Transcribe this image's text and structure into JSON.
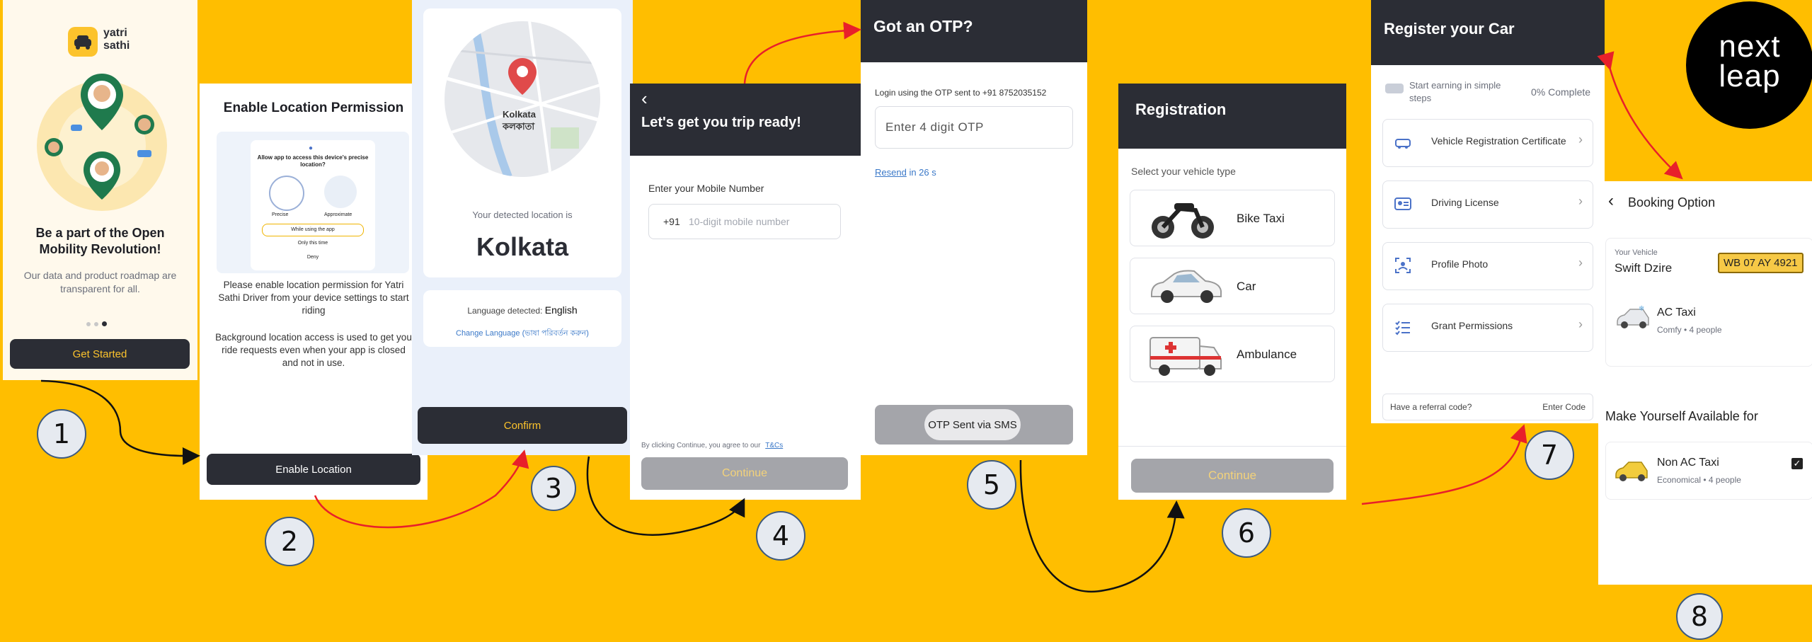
{
  "screen1": {
    "brand_line1": "yatri",
    "brand_line2": "sathi",
    "headline": "Be a part of the Open Mobility Revolution!",
    "subtext": "Our data and product roadmap are transparent for all.",
    "cta": "Get Started"
  },
  "screen2": {
    "title": "Enable Location Permission",
    "dialog_title": "Allow app to access this device's precise location?",
    "precise": "Precise",
    "approximate": "Approximate",
    "opt_while": "While using the app",
    "opt_once": "Only this time",
    "opt_deny": "Deny",
    "para1": "Please enable location permission for Yatri Sathi Driver from your device settings to start riding",
    "para2": "Background location access is used to get you ride requests even when your app is closed and not in use.",
    "cta": "Enable Location"
  },
  "screen3": {
    "map_label_en": "Kolkata",
    "map_label_bn": "কলকাতা",
    "detected_label": "Your detected location is",
    "city": "Kolkata",
    "lang_label": "Language detected:",
    "lang_value": "English",
    "change_lang": "Change Language (ভাষা পরিবর্তন করুন)",
    "cta": "Confirm"
  },
  "screen4": {
    "back": "‹",
    "title": "Let's get you trip ready!",
    "mobile_label": "Enter your Mobile Number",
    "prefix": "+91",
    "mobile_placeholder": "10-digit mobile number",
    "terms_prefix": "By clicking Continue, you agree to our",
    "terms_link": "T&Cs",
    "cta": "Continue"
  },
  "screen5": {
    "title": "Got an OTP?",
    "sent_to": "Login using the OTP sent to +91 8752035152",
    "otp_placeholder": "Enter 4 digit OTP",
    "resend_link": "Resend",
    "resend_timer": "in 26 s",
    "toast": "OTP Sent via SMS"
  },
  "screen6": {
    "title": "Registration",
    "select_label": "Select your vehicle type",
    "vehicles": [
      "Bike Taxi",
      "Car",
      "Ambulance"
    ],
    "cta": "Continue"
  },
  "screen7": {
    "title": "Register your Car",
    "earning": "Start earning in simple steps",
    "progress": "0% Complete",
    "docs": [
      "Vehicle Registration Certificate",
      "Driving License",
      "Profile Photo",
      "Grant Permissions"
    ],
    "referral": "Have a referral code?",
    "enter_code": "Enter Code"
  },
  "screen8": {
    "back": "‹",
    "title": "Booking Option",
    "your_vehicle": "Your Vehicle",
    "vehicle_name": "Swift Dzire",
    "plate": "WB 07 AY 4921",
    "ac_title": "AC Taxi",
    "ac_sub": "Comfy • 4 people",
    "available_title": "Make Yourself Available for",
    "nonac_title": "Non AC Taxi",
    "nonac_sub": "Economical • 4 people"
  },
  "logo": {
    "line1": "next",
    "line2": "leap"
  },
  "steps": [
    "1",
    "2",
    "3",
    "4",
    "5",
    "6",
    "7",
    "8"
  ],
  "colors": {
    "background": "#FFBE00",
    "dark": "#2B2D35",
    "accent": "#FCC32C",
    "arrow_red": "#E8202A",
    "link": "#3A78C8"
  }
}
